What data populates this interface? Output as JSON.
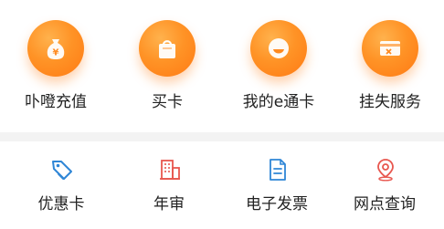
{
  "top_menu": {
    "items": [
      {
        "label": "卟噔充值",
        "icon": "money-bag-icon"
      },
      {
        "label": "买卡",
        "icon": "shopping-bag-icon"
      },
      {
        "label": "我的e通卡",
        "icon": "smile-card-icon"
      },
      {
        "label": "挂失服务",
        "icon": "card-cancel-icon"
      }
    ],
    "accent_color": "#ff8a1f"
  },
  "bottom_menu": {
    "items": [
      {
        "label": "优惠卡",
        "icon": "tag-icon",
        "color": "#2f86d6"
      },
      {
        "label": "年审",
        "icon": "building-icon",
        "color": "#e8574f"
      },
      {
        "label": "电子发票",
        "icon": "document-icon",
        "color": "#2f86d6"
      },
      {
        "label": "网点查询",
        "icon": "location-pin-icon",
        "color": "#e8574f"
      }
    ]
  }
}
